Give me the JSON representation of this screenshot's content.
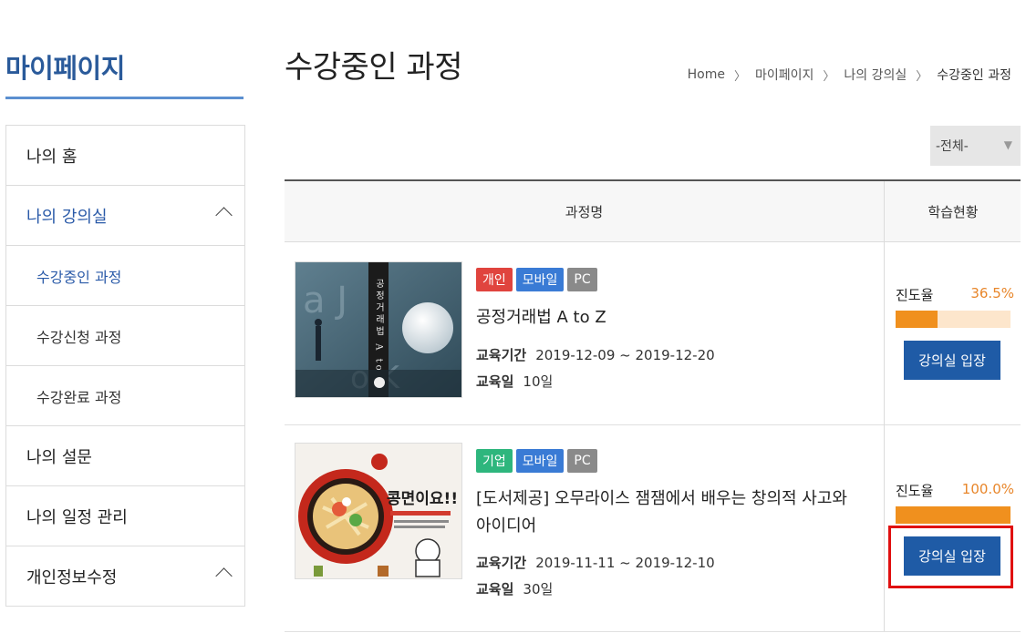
{
  "sidebar": {
    "title": "마이페이지",
    "items": [
      {
        "label": "나의 홈"
      },
      {
        "label": "나의 강의실"
      },
      {
        "label": "수강중인 과정"
      },
      {
        "label": "수강신청 과정"
      },
      {
        "label": "수강완료 과정"
      },
      {
        "label": "나의 설문"
      },
      {
        "label": "나의 일정 관리"
      },
      {
        "label": "개인정보수정"
      }
    ]
  },
  "header": {
    "title": "수강중인 과정",
    "breadcrumb": [
      "Home",
      "마이페이지",
      "나의 강의실",
      "수강중인 과정"
    ]
  },
  "filter": {
    "selected": "-전체-"
  },
  "table": {
    "headers": [
      "과정명",
      "학습현황"
    ],
    "rows": [
      {
        "badges": [
          "개인",
          "모바일",
          "PC"
        ],
        "title": "공정거래법 A to Z",
        "period_label": "교육기간",
        "period": "2019-12-09 ~ 2019-12-20",
        "days_label": "교육일",
        "days": "10일",
        "progress_label": "진도율",
        "progress_text": "36.5%",
        "progress": 0.365,
        "button": "강의실 입장"
      },
      {
        "badges": [
          "기업",
          "모바일",
          "PC"
        ],
        "title": "[도서제공] 오무라이스 잼잼에서 배우는 창의적 사고와 아이디어",
        "period_label": "교육기간",
        "period": "2019-11-11 ~ 2019-12-10",
        "days_label": "교육일",
        "days": "30일",
        "progress_label": "진도율",
        "progress_text": "100.0%",
        "progress": 1.0,
        "button": "강의실 입장"
      }
    ]
  },
  "thumb1": {
    "vertical_title": "공정거래법 A to Z"
  },
  "thumb2": {
    "headline": "콩면이요!!"
  },
  "colors": {
    "accent": "#2a5a9a",
    "button": "#1f5ba6",
    "progress": "#f0901e",
    "highlight": "#e01010"
  }
}
